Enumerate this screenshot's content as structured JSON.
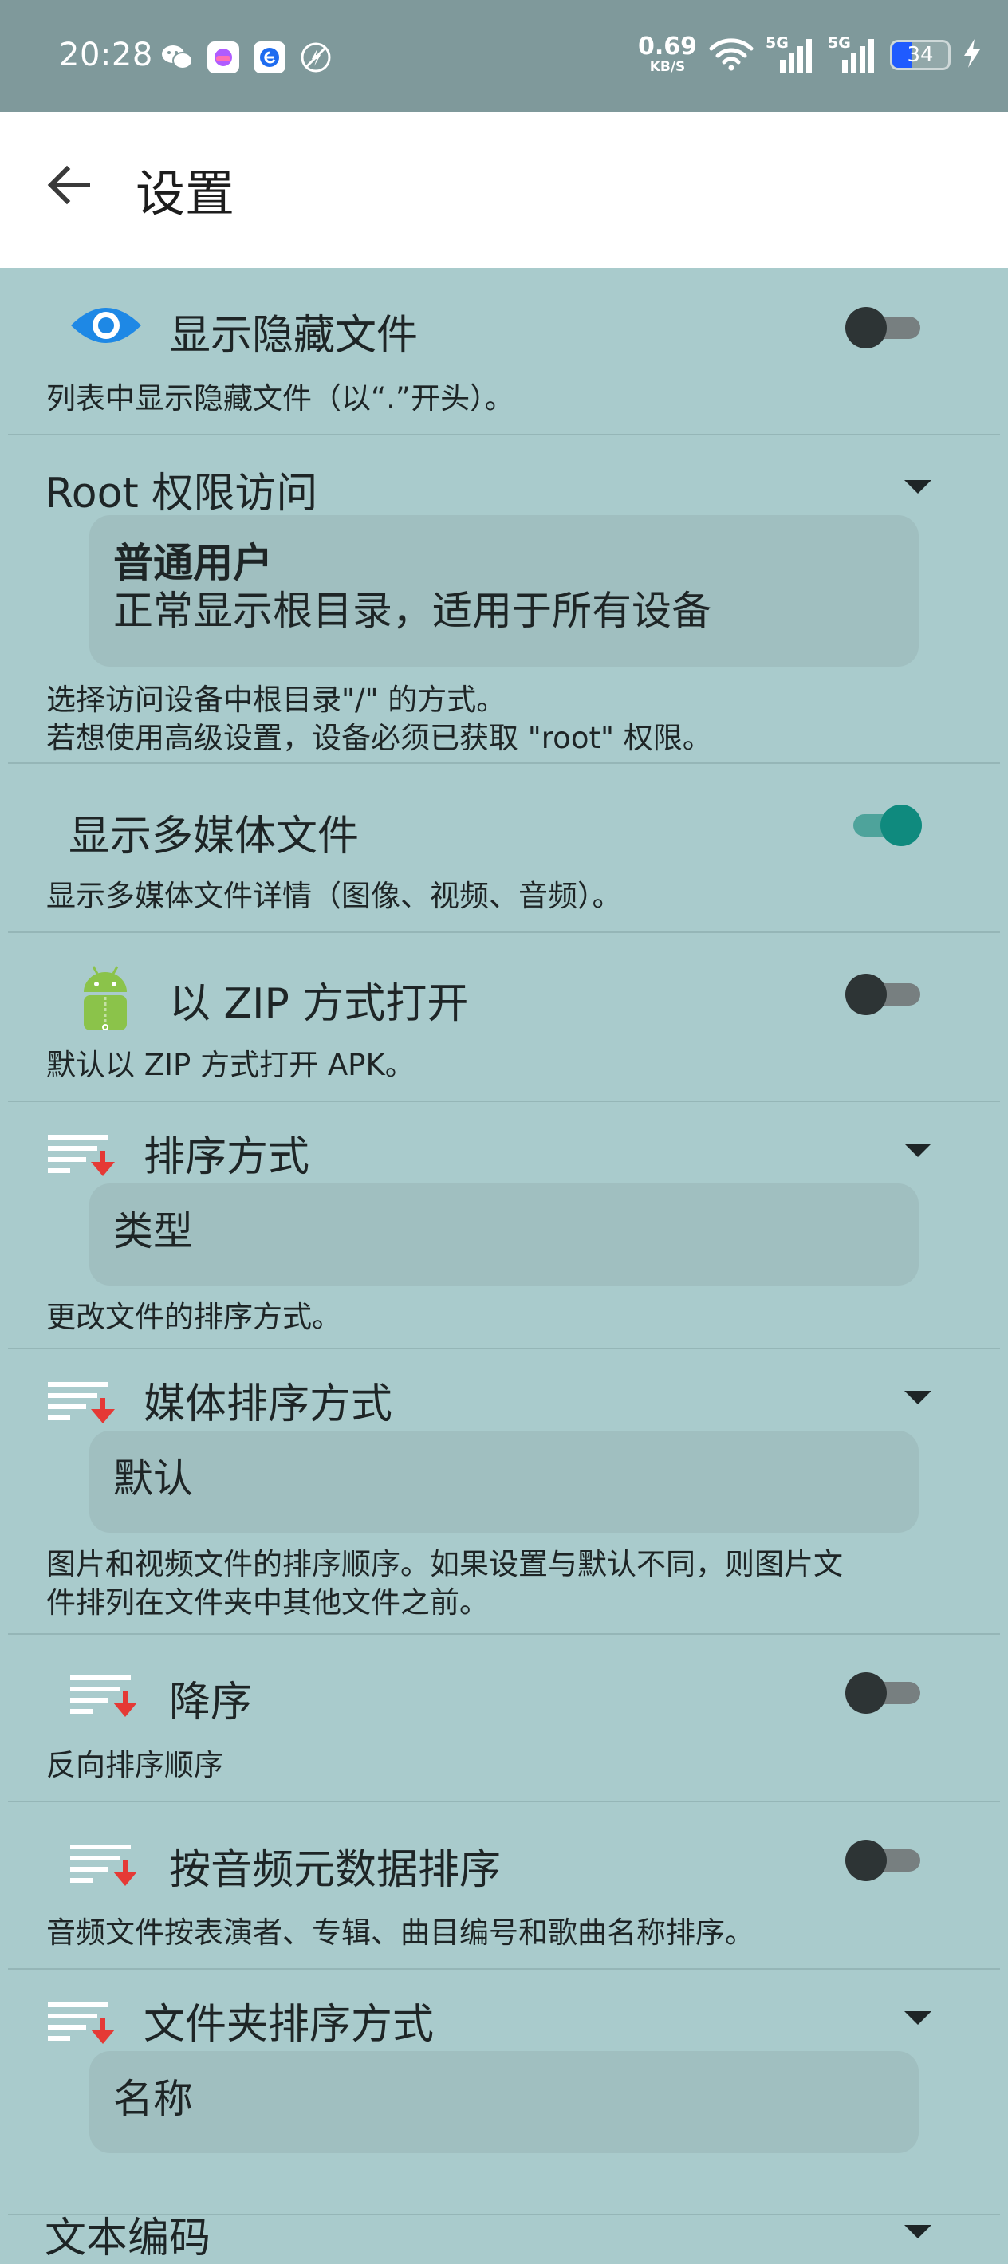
{
  "status_bar": {
    "time": "20:28",
    "net_speed": "0.69",
    "net_unit": "KB/S",
    "sim1": "5G",
    "sim2": "5G",
    "battery": "34",
    "battery_level": 0.34
  },
  "app_bar": {
    "title": "设置"
  },
  "settings": {
    "hidden_files": {
      "title": "显示隐藏文件",
      "summary": "列表中显示隐藏文件（以“.”开头）。",
      "enabled": false
    },
    "root_access": {
      "title": "Root 权限访问",
      "value_title": "普通用户",
      "value_desc": "正常显示根目录，适用于所有设备",
      "summary_line1": "选择访问设备中根目录\"/\" 的方式。",
      "summary_line2": "若想使用高级设置，设备必须已获取 \"root\" 权限。"
    },
    "media_files": {
      "title": "显示多媒体文件",
      "summary": "显示多媒体文件详情（图像、视频、音频）。",
      "enabled": true
    },
    "zip_open": {
      "title": "以 ZIP 方式打开",
      "summary": "默认以 ZIP 方式打开 APK。",
      "enabled": false
    },
    "sort_mode": {
      "title": "排序方式",
      "value": "类型",
      "summary": "更改文件的排序方式。"
    },
    "media_sort": {
      "title": "媒体排序方式",
      "value": "默认",
      "summary_line1": "图片和视频文件的排序顺序。如果设置与默认不同，则图片文",
      "summary_line2": "件排列在文件夹中其他文件之前。"
    },
    "descending": {
      "title": "降序",
      "summary": "反向排序顺序",
      "enabled": false
    },
    "audio_meta_sort": {
      "title": "按音频元数据排序",
      "summary": "音频文件按表演者、专辑、曲目编号和歌曲名称排序。",
      "enabled": false
    },
    "folder_sort": {
      "title": "文件夹排序方式",
      "value": "名称"
    },
    "text_encoding": {
      "title": "文本编码"
    }
  },
  "colors": {
    "background": "#a9cbcc",
    "status_bar": "#7f999b",
    "switch_on": "#0f8a7e",
    "switch_off": "#2d3435",
    "sort_arrow": "#e53935"
  }
}
